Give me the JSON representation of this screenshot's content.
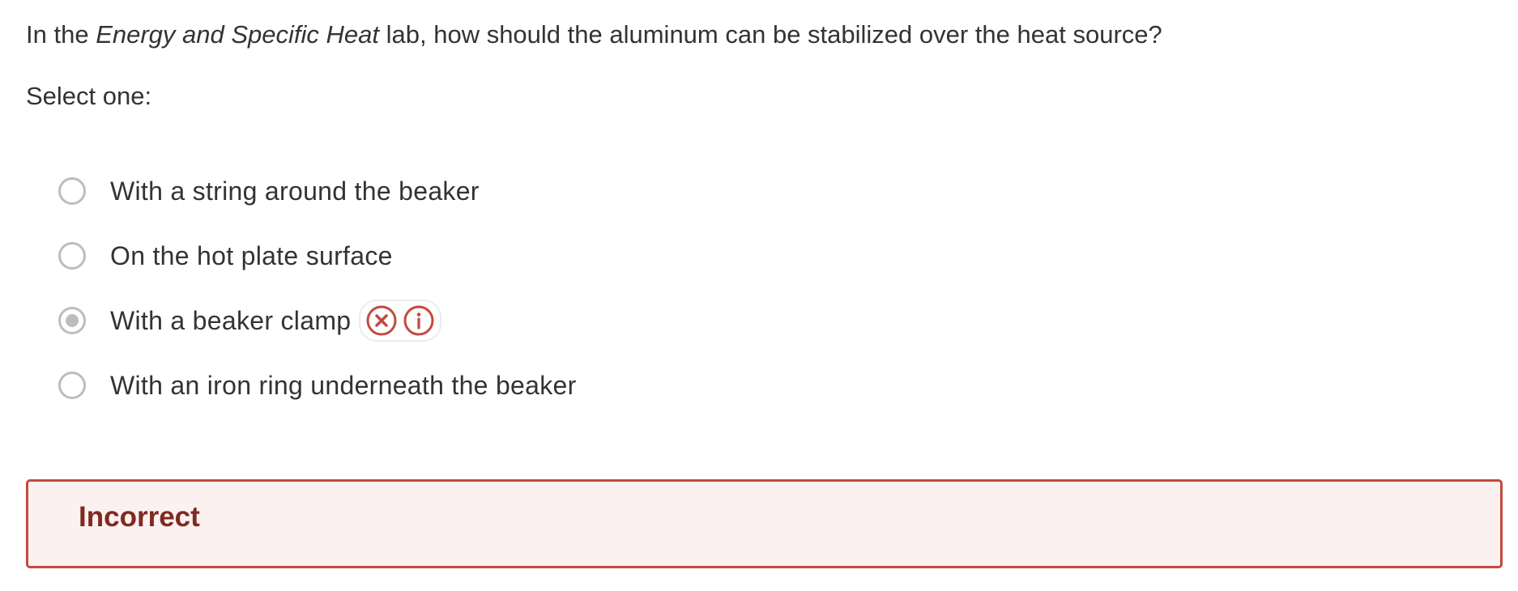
{
  "question": {
    "prefix": "In the ",
    "emphasis": "Energy and Specific Heat",
    "suffix": " lab, how should the aluminum can be stabilized over the heat source?"
  },
  "instruction": "Select one:",
  "options": [
    {
      "label": "With a string around the beaker",
      "selected": false
    },
    {
      "label": "On the hot plate surface",
      "selected": false
    },
    {
      "label": "With a beaker clamp",
      "selected": true,
      "feedback_icons": [
        "incorrect-x-icon",
        "info-icon"
      ]
    },
    {
      "label": "With an iron ring underneath the beaker",
      "selected": false
    }
  ],
  "result": {
    "title": "Incorrect"
  },
  "colors": {
    "text": "#333333",
    "radio_border": "#bdbdbd",
    "error_red": "#c24a3f",
    "error_bg": "#fbf1f0",
    "error_title": "#7e2a22"
  }
}
